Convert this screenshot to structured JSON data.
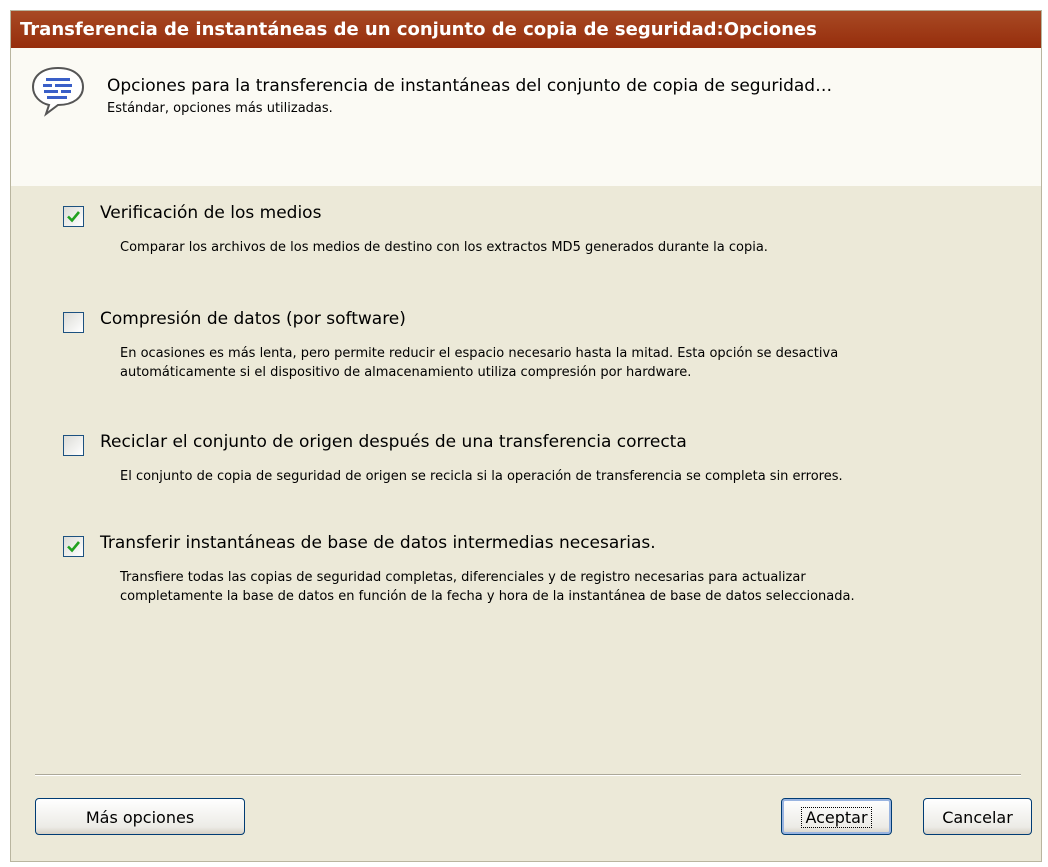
{
  "window": {
    "title": "Transferencia de instantáneas de un conjunto de copia de seguridad:Opciones"
  },
  "header": {
    "icon": "speech-bubble-icon",
    "title": "Opciones para la transferencia de instantáneas del conjunto de copia de seguridad…",
    "subtitle": "Estándar, opciones más utilizadas."
  },
  "options": [
    {
      "label": "Verificación de los medios",
      "checked": true,
      "description": "Comparar los archivos de los medios de destino con los extractos MD5 generados durante la copia."
    },
    {
      "label": "Compresión de datos (por software)",
      "checked": false,
      "description": "En ocasiones es más lenta, pero permite reducir el espacio necesario hasta la mitad. Esta opción se desactiva automáticamente si el dispositivo de almacenamiento utiliza compresión por hardware."
    },
    {
      "label": "Reciclar el conjunto de origen después de una transferencia correcta",
      "checked": false,
      "description": "El conjunto de copia de seguridad de origen se recicla si la operación de transferencia se completa sin errores."
    },
    {
      "label": "Transferir instantáneas de base de datos intermedias necesarias.",
      "checked": true,
      "description": "Transfiere todas las copias de seguridad completas, diferenciales y de registro necesarias para actualizar completamente la base de datos en función de la fecha y hora de la instantánea de base de datos seleccionada."
    }
  ],
  "buttons": {
    "more": "Más opciones",
    "accept": "Aceptar",
    "cancel": "Cancelar"
  },
  "colors": {
    "titlebar": "#9a300f",
    "dialog_bg": "#ece9d8",
    "header_bg": "#fbfaf4",
    "checkmark": "#21a121"
  }
}
